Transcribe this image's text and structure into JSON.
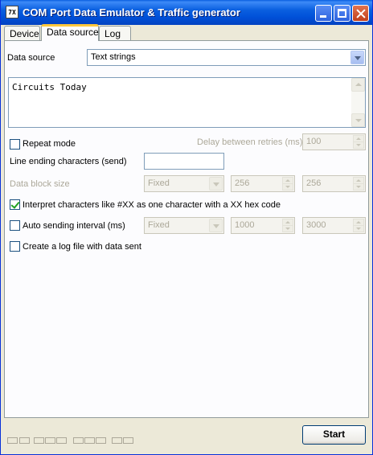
{
  "window": {
    "icon_text": "7X",
    "title": "COM Port Data Emulator & Traffic generator"
  },
  "tabs": [
    {
      "label": "Device"
    },
    {
      "label": "Data source"
    },
    {
      "label": "Log"
    }
  ],
  "data_source": {
    "label": "Data source",
    "selected": "Text strings"
  },
  "text_content": "Circuits Today",
  "repeat_mode": {
    "label": "Repeat mode",
    "checked": false
  },
  "delay": {
    "label": "Delay between retries (ms)",
    "value": "100"
  },
  "line_ending": {
    "label": "Line ending characters (send)",
    "value": ""
  },
  "data_block": {
    "label": "Data block size",
    "mode": "Fixed",
    "min": "256",
    "max": "256"
  },
  "interpret_hex": {
    "label": "Interpret characters like #XX as one character with a XX hex code",
    "checked": true
  },
  "auto_sending": {
    "label": "Auto sending interval (ms)",
    "checked": false,
    "mode": "Fixed",
    "min": "1000",
    "max": "3000"
  },
  "log_file": {
    "label": "Create a log file with data sent",
    "checked": false
  },
  "start_button": {
    "label": "Start"
  }
}
